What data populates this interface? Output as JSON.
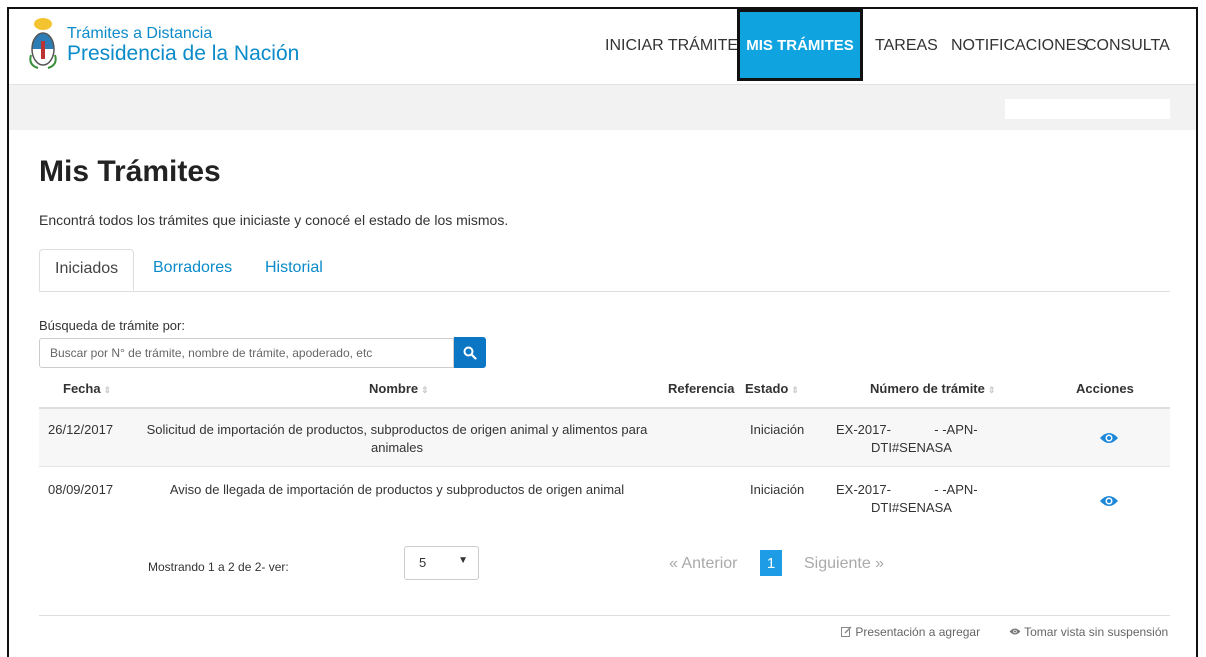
{
  "header": {
    "brand_line1": "Trámites a Distancia",
    "brand_line2": "Presidencia de la Nación",
    "nav": [
      "INICIAR TRÁMITE",
      "MIS TRÁMITES",
      "TAREAS",
      "NOTIFICACIONES",
      "CONSULTA"
    ],
    "active_nav": "MIS TRÁMITES"
  },
  "page": {
    "title": "Mis Trámites",
    "subtitle": "Encontrá todos los trámites que iniciaste y conocé el estado de los mismos."
  },
  "tabs": [
    "Iniciados",
    "Borradores",
    "Historial"
  ],
  "active_tab": "Iniciados",
  "search": {
    "label": "Búsqueda de trámite por:",
    "placeholder": "Buscar por N° de trámite, nombre de trámite, apoderado, etc",
    "icon": "search-icon"
  },
  "table": {
    "headers": {
      "fecha": "Fecha",
      "nombre": "Nombre",
      "referencia": "Referencia",
      "estado": "Estado",
      "numero": "Número de trámite",
      "acciones": "Acciones"
    },
    "rows": [
      {
        "fecha": "26/12/2017",
        "nombre_line1": "Solicitud de importación de productos, subproductos de origen animal y alimentos para",
        "nombre_line2": "animales",
        "referencia": "",
        "estado": "Iniciación",
        "numero_line1": "EX-2017-            - -APN-",
        "numero_line2": "DTI#SENASA",
        "action_icon": "eye-icon"
      },
      {
        "fecha": "08/09/2017",
        "nombre_line1": "Aviso de llegada de importación de productos y subproductos de origen animal",
        "nombre_line2": "",
        "referencia": "",
        "estado": "Iniciación",
        "numero_line1": "EX-2017-            - -APN-",
        "numero_line2": "DTI#SENASA",
        "action_icon": "eye-icon"
      }
    ]
  },
  "pagination": {
    "showing": "Mostrando 1 a 2 de 2- ver:",
    "page_size": "5",
    "prev": "« Anterior",
    "current": "1",
    "next": "Siguiente »"
  },
  "footer": {
    "link1": "Presentación a agregar",
    "link2": "Tomar vista sin suspensión"
  },
  "colors": {
    "primary": "#0b8bc9",
    "active_nav_bg": "#0fa3df",
    "search_button": "#0b77c4",
    "current_page": "#1e9ce6"
  }
}
